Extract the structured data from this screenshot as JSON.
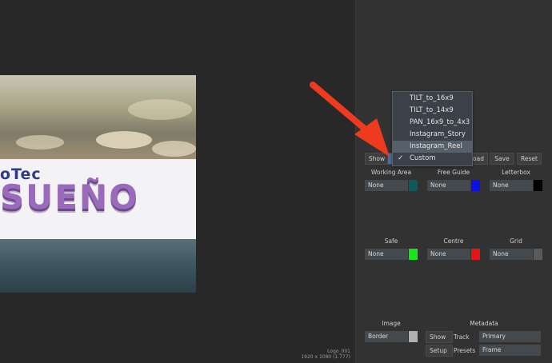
{
  "viewer": {
    "logo_top": "oTec",
    "logo_main": "SUEÑO",
    "caption_line1": "Logo_001",
    "caption_line2": "1920 x 1080 (1.777)"
  },
  "toolbar": {
    "show_label": "Show",
    "load_label": "Load",
    "save_label": "Save",
    "reset_label": "Reset"
  },
  "dropdown": {
    "items": [
      {
        "label": "TILT_to_16x9",
        "checked": false
      },
      {
        "label": "TILT_to_14x9",
        "checked": false
      },
      {
        "label": "PAN_16x9_to_4x3",
        "checked": false
      },
      {
        "label": "Instagram_Story",
        "checked": false
      },
      {
        "label": "Instagram_Reel",
        "checked": false,
        "highlighted": true
      },
      {
        "label": "Custom",
        "checked": true
      }
    ],
    "check_glyph": "✓"
  },
  "guides": {
    "working_area": {
      "label": "Working Area",
      "value": "None",
      "color": "#0d5a5a"
    },
    "free_guide": {
      "label": "Free Guide",
      "value": "None",
      "color": "#0a10e6"
    },
    "letterbox": {
      "label": "Letterbox",
      "value": "None",
      "color": "#000000"
    },
    "safe": {
      "label": "Safe",
      "value": "None",
      "color": "#19e619"
    },
    "centre": {
      "label": "Centre",
      "value": "None",
      "color": "#e61414"
    },
    "grid": {
      "label": "Grid",
      "value": "None",
      "color": "#5a5a5a"
    }
  },
  "image": {
    "label": "Image",
    "value": "Border",
    "color": "#b0b0b0"
  },
  "metadata": {
    "label": "Metadata",
    "show_button": "Show",
    "setup_button": "Setup",
    "track_label": "Track",
    "track_value": "Primary",
    "presets_label": "Presets",
    "presets_value": "Frame"
  },
  "arrow_color": "#ee3b1f",
  "icons": [
    "check-icon",
    "red-arrow-icon"
  ]
}
